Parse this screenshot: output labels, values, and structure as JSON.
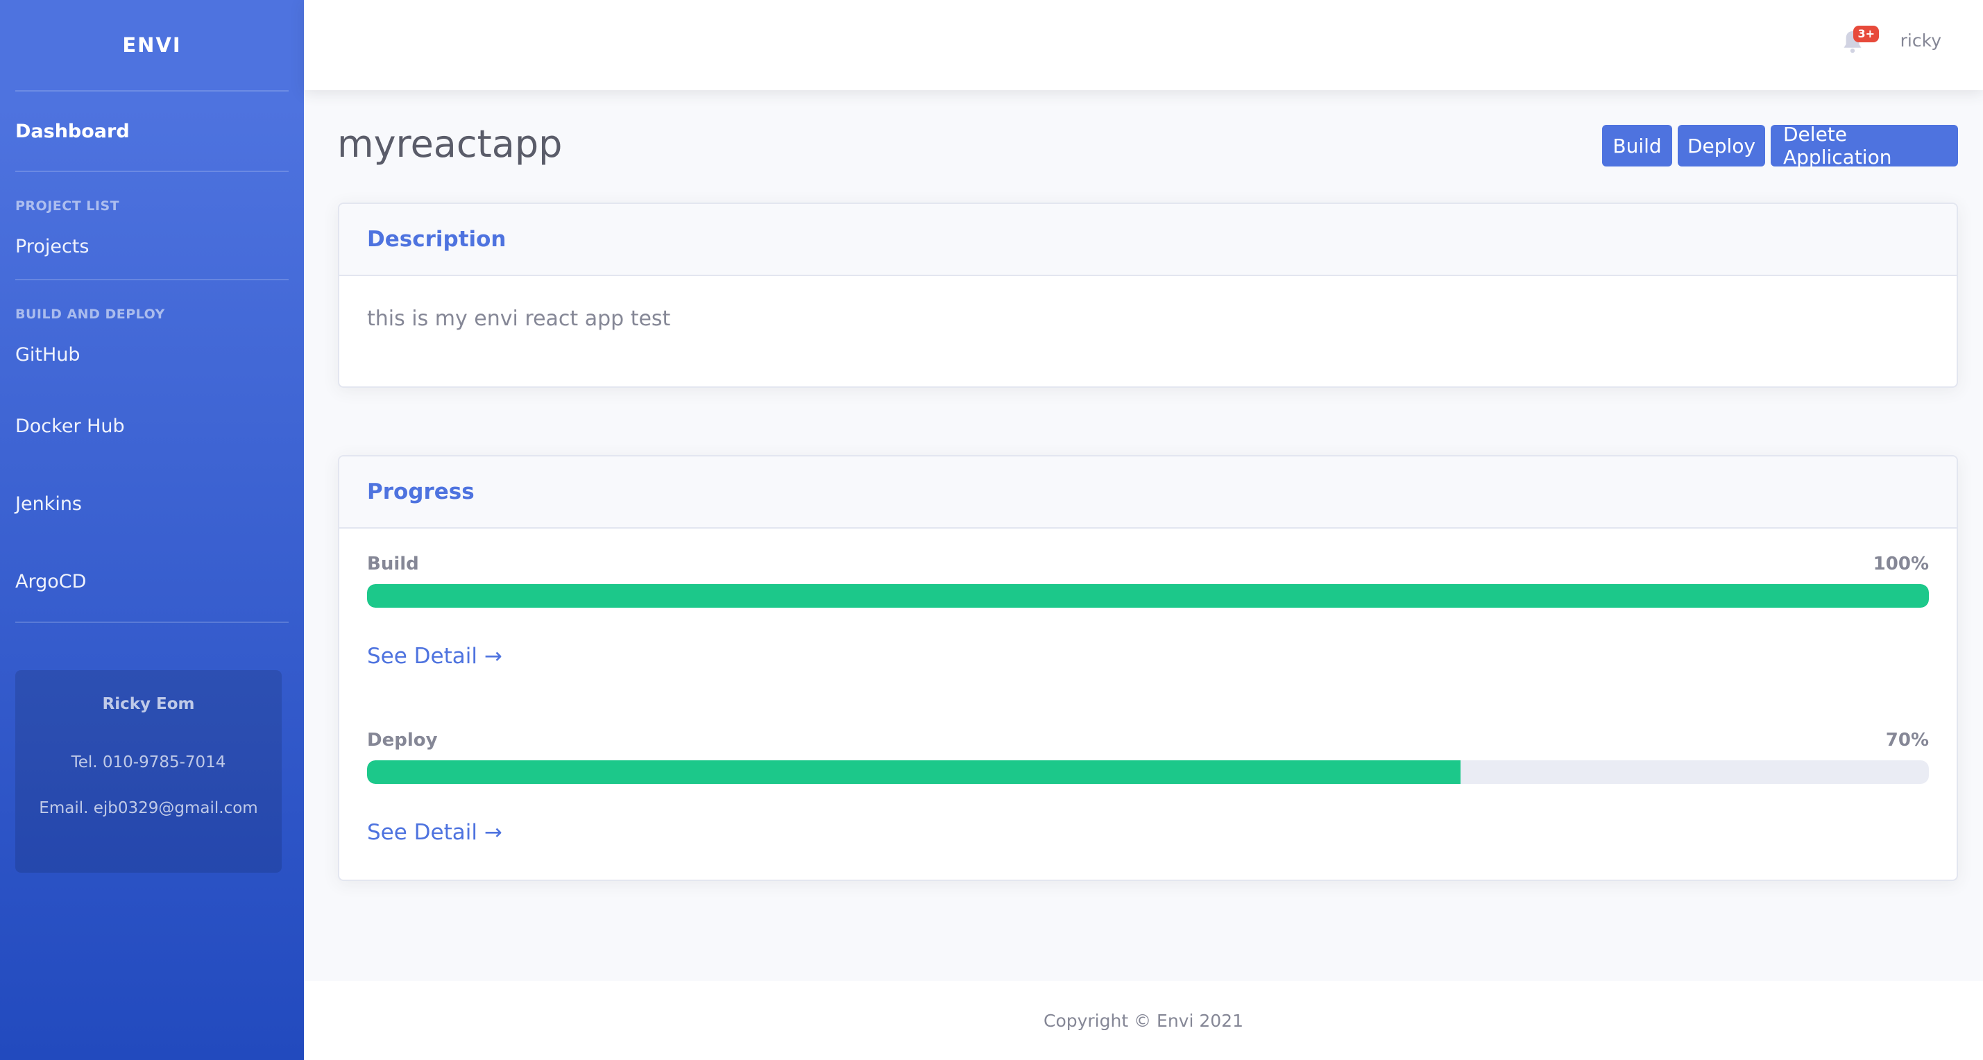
{
  "sidebar": {
    "brand": "ENVI",
    "dashboard": "Dashboard",
    "heading_projects": "PROJECT LIST",
    "projects": "Projects",
    "heading_build": "BUILD AND DEPLOY",
    "github": "GitHub",
    "dockerhub": "Docker Hub",
    "jenkins": "Jenkins",
    "argocd": "ArgoCD",
    "profile": {
      "name": "Ricky Eom",
      "tel": "Tel. 010-9785-7014",
      "email": "Email. ejb0329@gmail.com"
    }
  },
  "topbar": {
    "badge": "3+",
    "username": "ricky",
    "bell_icon": "bell-icon"
  },
  "main": {
    "title": "myreactapp",
    "buttons": {
      "build": "Build",
      "deploy": "Deploy",
      "delete": "Delete Application"
    },
    "description": {
      "header": "Description",
      "text": "this is my envi react app test"
    },
    "progress": {
      "header": "Progress",
      "build_label": "Build",
      "build_percent": "100%",
      "build_value": 100,
      "deploy_label": "Deploy",
      "deploy_percent": "70%",
      "deploy_value": 70,
      "see_detail": "See Detail →"
    }
  },
  "footer": {
    "copyright": "Copyright © Envi 2021"
  },
  "colors": {
    "primary": "#4e73df",
    "success": "#1cc88a",
    "danger": "#e74a3b"
  }
}
